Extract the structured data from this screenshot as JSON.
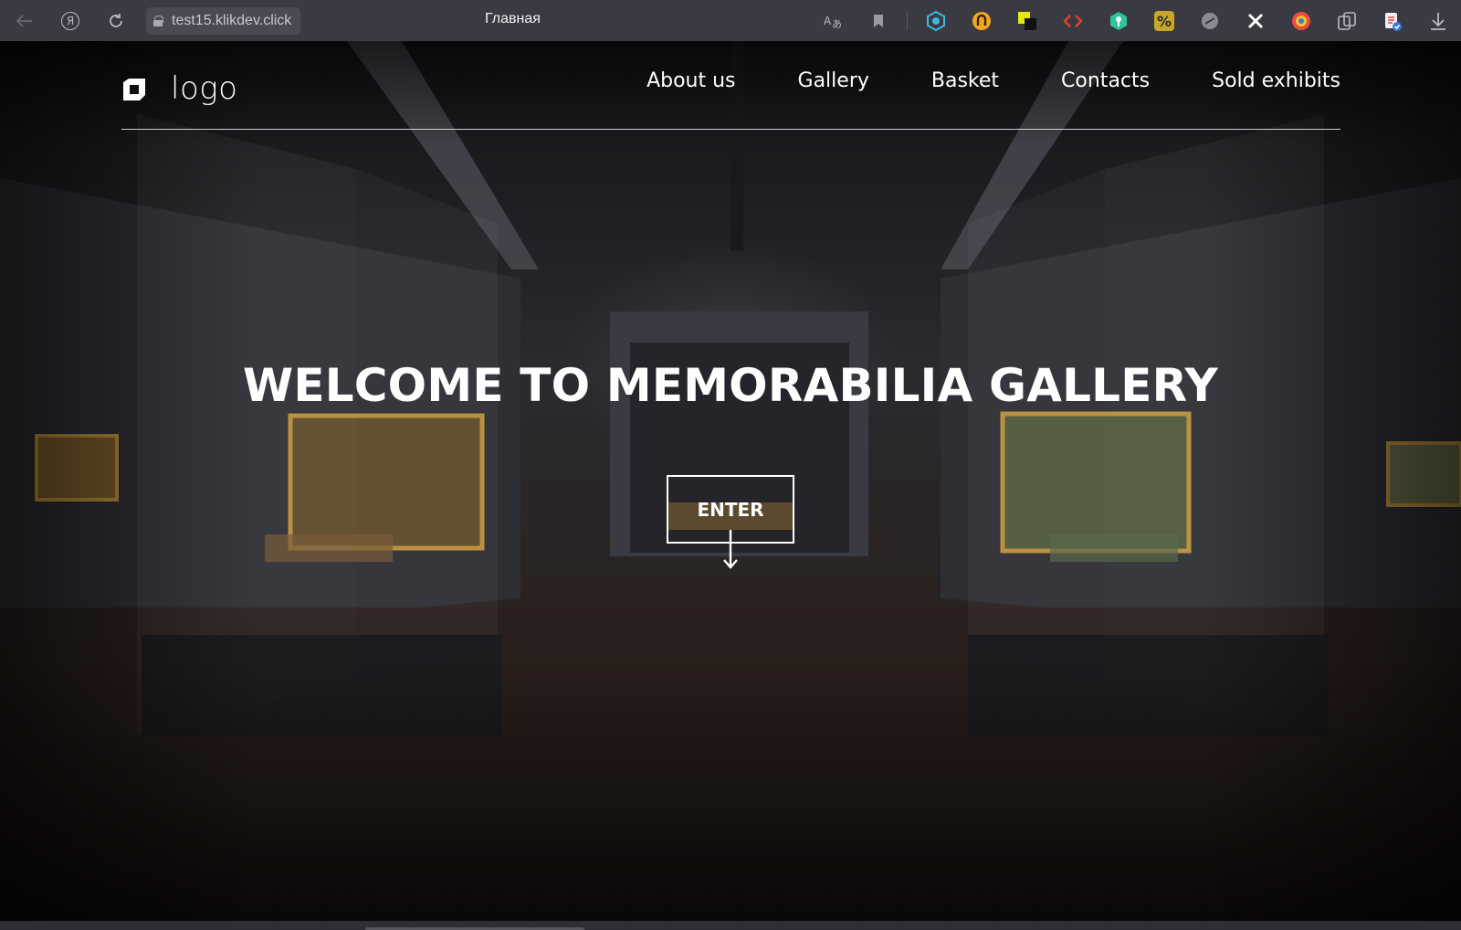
{
  "browser": {
    "url": "test15.klikdev.click",
    "tab_title": "Главная",
    "ext_colors": [
      "#3bb8e0",
      "#f5a623",
      "#e8e800",
      "#e0442e",
      "#2ec4a0",
      "#c9a627",
      "#8a8a92",
      "#ffffff",
      "#e84d3d"
    ]
  },
  "header": {
    "logo_text": "logo",
    "nav": [
      {
        "label": "About us"
      },
      {
        "label": "Gallery"
      },
      {
        "label": "Basket"
      },
      {
        "label": "Contacts"
      },
      {
        "label": "Sold exhibits"
      }
    ]
  },
  "hero": {
    "title": "WELCOME TO MEMORABILIA GALLERY",
    "enter_label": "ENTER"
  },
  "colors": {
    "text": "#ffffff",
    "chrome_bg": "#3a3a43",
    "page_bg": "#1b1b1f"
  }
}
